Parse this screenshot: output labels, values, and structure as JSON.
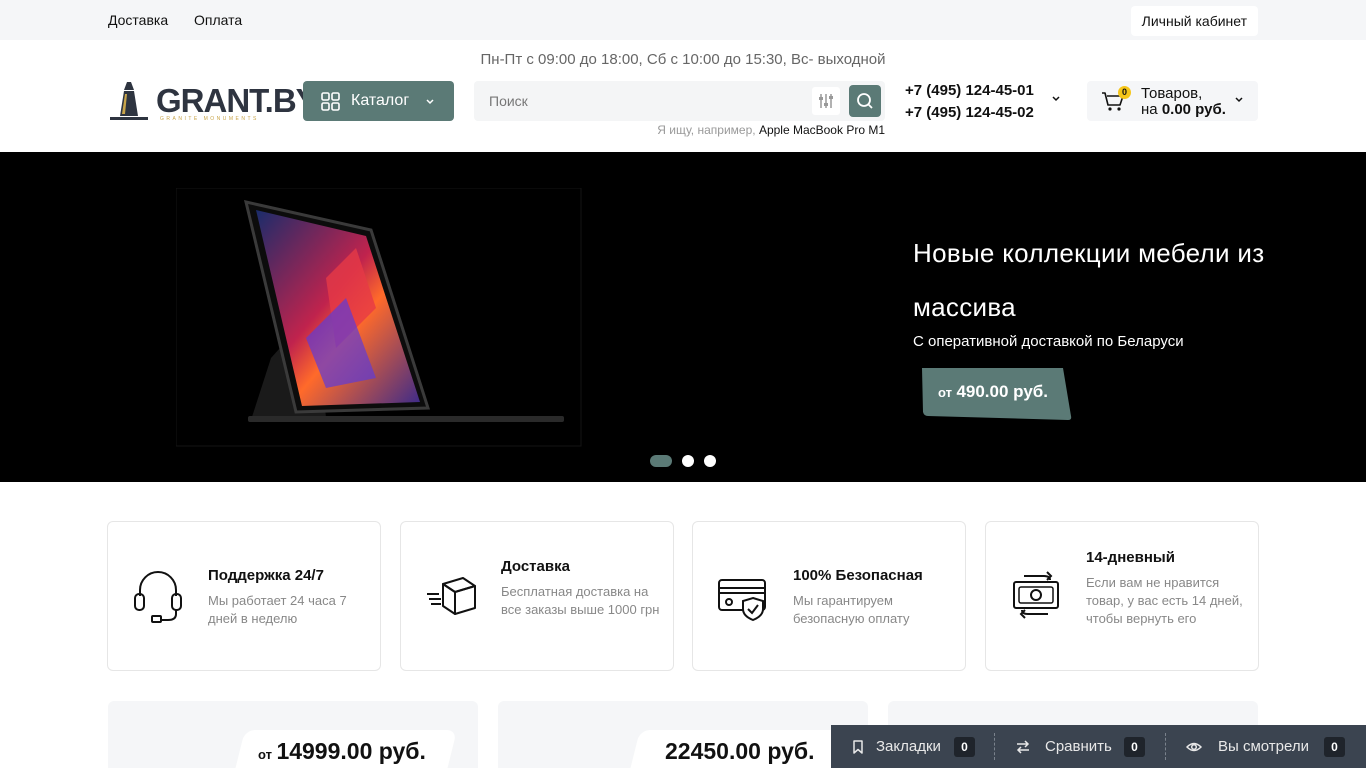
{
  "topbar": {
    "links": [
      "Доставка",
      "Оплата"
    ],
    "account_label": "Личный кабинет"
  },
  "header": {
    "hours": "Пн-Пт с 09:00 до 18:00, Сб с 10:00 до 15:30, Вс- выходной",
    "logo_text": "GRANT.BY",
    "logo_subtext": "GRANITE MONUMENTS",
    "catalog_label": "Каталог",
    "search": {
      "placeholder": "Поиск",
      "hint_prefix": "Я ищу, например,",
      "hint_example": "Apple MacBook Pro M1"
    },
    "phones": [
      "+7 (495) 124-45-01",
      "+7 (495) 124-45-02"
    ],
    "cart": {
      "count": "0",
      "line1": "Товаров,",
      "line2_prefix": "на",
      "line2_amount": "0.00 руб."
    }
  },
  "hero": {
    "title": "Новые коллекции мебели из массива",
    "subtitle": "С оперативной доставкой по Беларуси",
    "price_prefix": "от",
    "price": "490.00 руб.",
    "slides_total": 3,
    "active_slide": 1
  },
  "features": [
    {
      "title": "Поддержка 24/7",
      "desc": "Мы работает 24 часа 7 дней в неделю",
      "icon": "headset-icon"
    },
    {
      "title": "Доставка",
      "desc": "Бесплатная доставка на все заказы выше 1000 грн",
      "icon": "delivery-box-icon"
    },
    {
      "title": "100% Безопасная",
      "desc": "Мы гарантируем безопасную оплату",
      "icon": "secure-card-icon"
    },
    {
      "title": "14-дневный",
      "desc": "Если вам не нравится товар, у вас есть 14 дней, чтобы вернуть его",
      "icon": "money-return-icon"
    }
  ],
  "products": [
    {
      "price_prefix": "от",
      "price": "14999.00 руб."
    },
    {
      "price_prefix": "",
      "price": "22450.00 руб."
    },
    {
      "price_prefix": "",
      "price": ""
    }
  ],
  "bottom_panel": {
    "bookmarks_label": "Закладки",
    "bookmarks_count": "0",
    "compare_label": "Сравнить",
    "compare_count": "0",
    "viewed_label": "Вы смотрели",
    "viewed_count": "0"
  },
  "colors": {
    "accent": "#5b7a76",
    "panel": "#3b4450",
    "badge": "#f6c61a"
  }
}
